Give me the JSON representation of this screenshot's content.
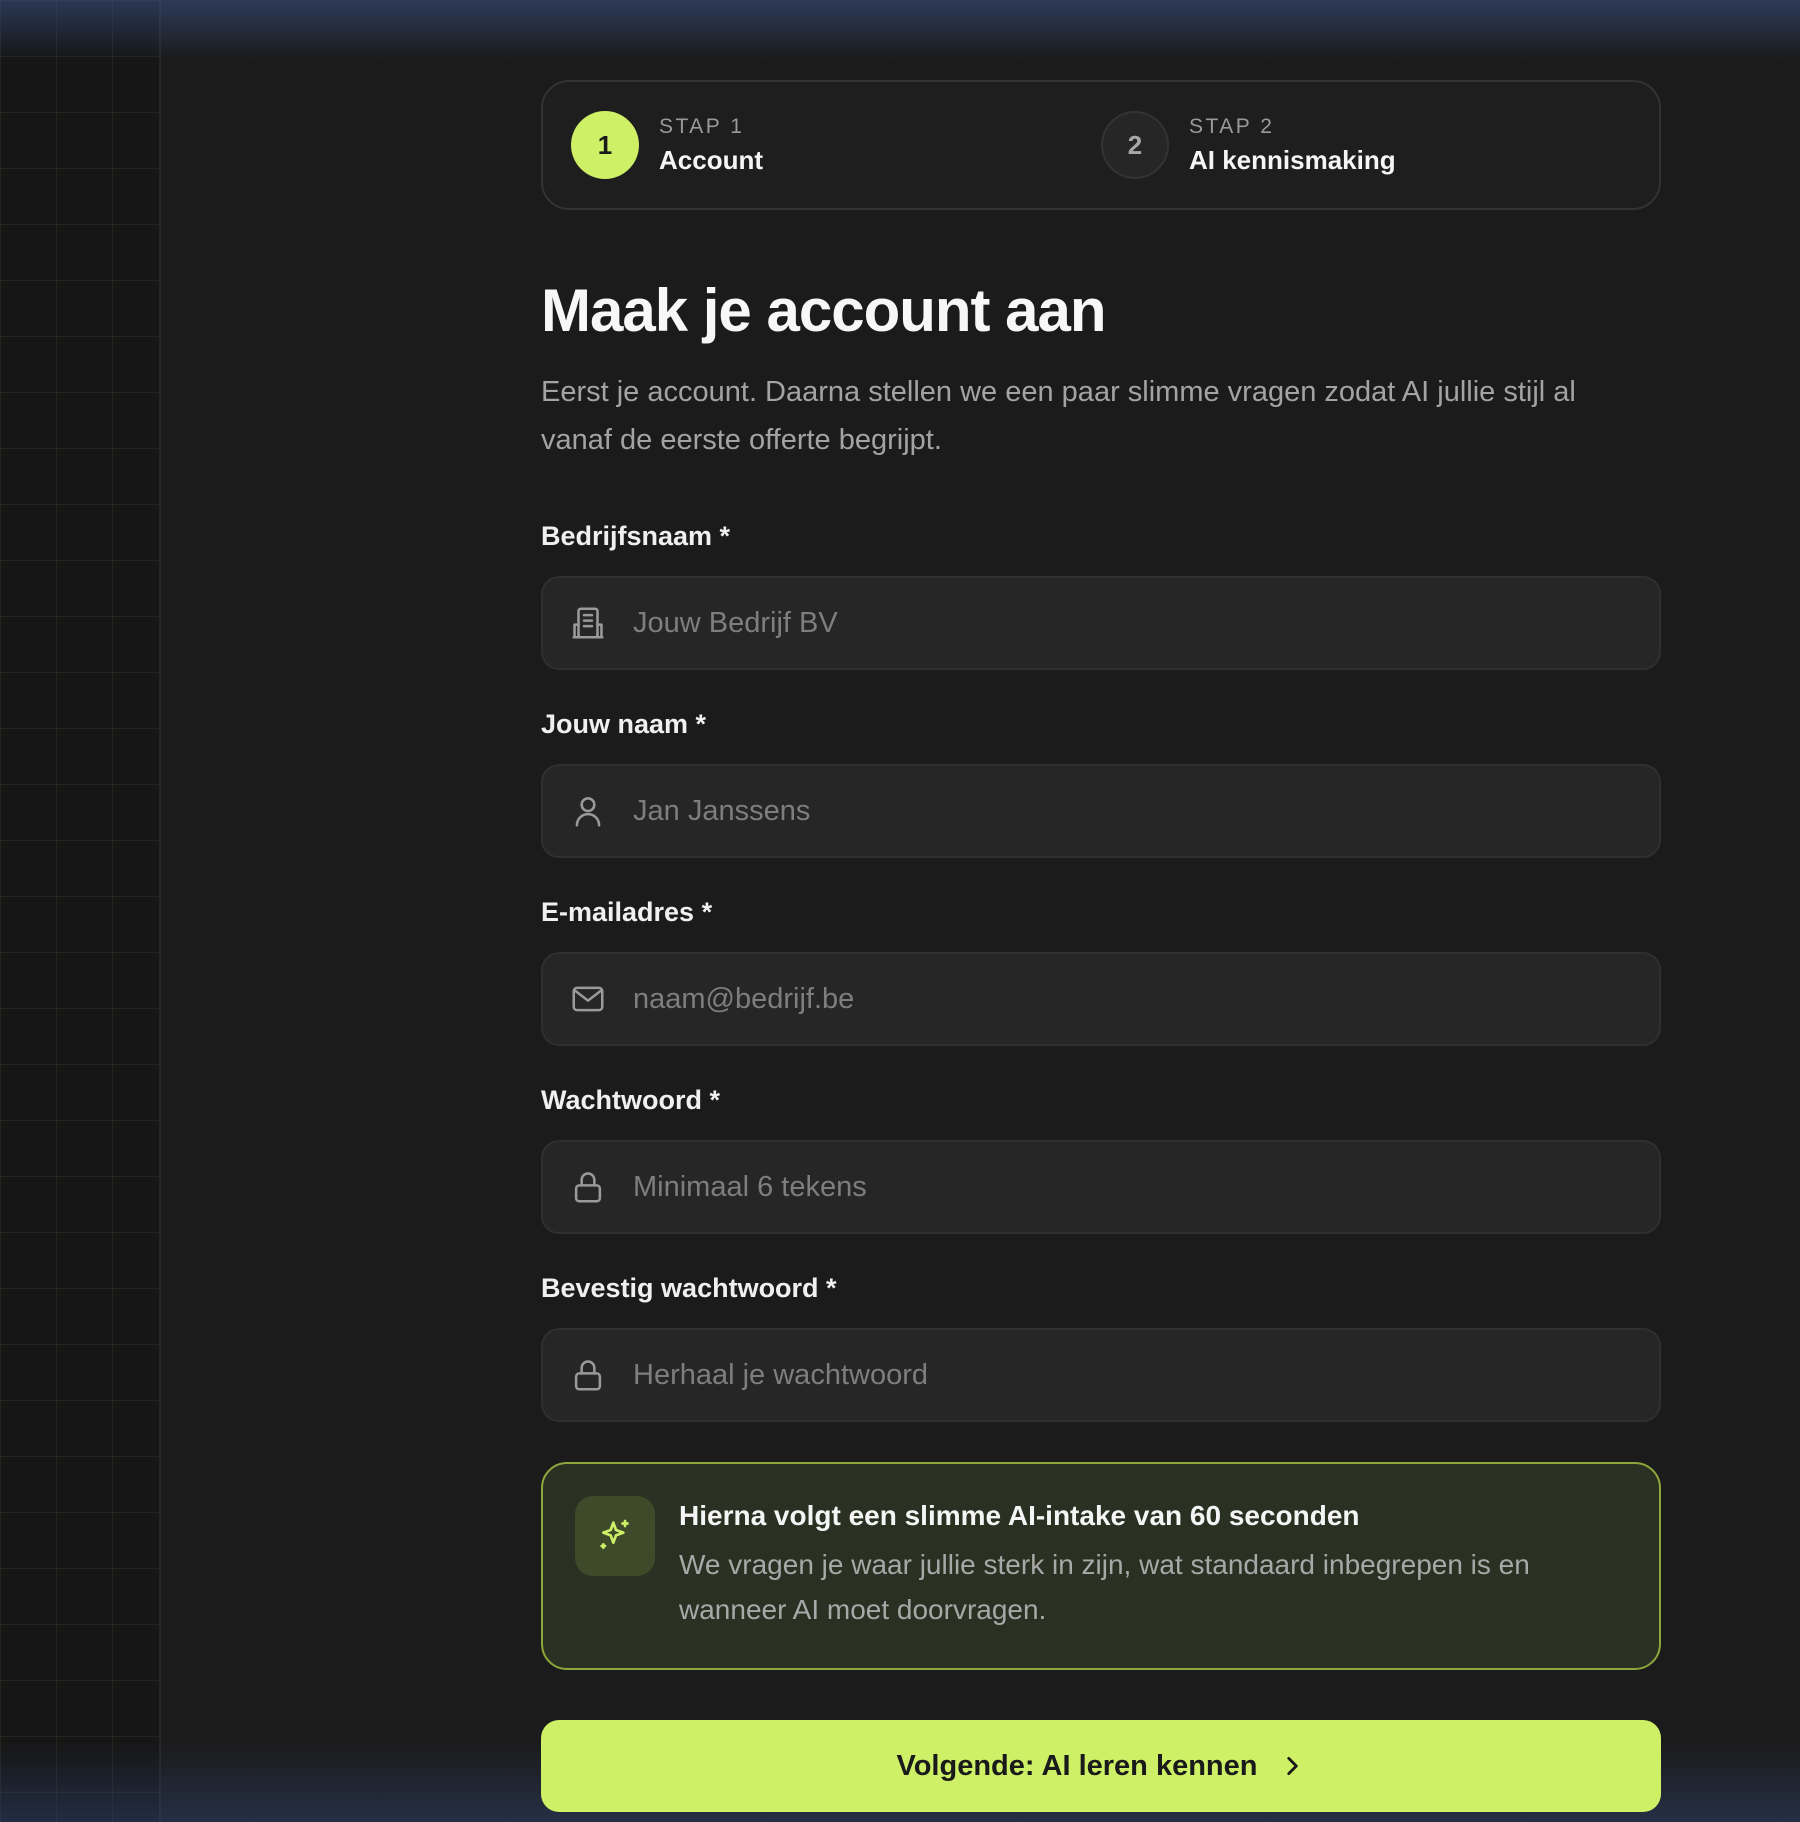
{
  "colors": {
    "accent": "#cdf066",
    "background": "#1b1b1b",
    "input_background": "#262626",
    "info_border": "#8ea63c"
  },
  "stepper": {
    "steps": [
      {
        "number": "1",
        "kicker": "STAP 1",
        "title": "Account",
        "state": "active"
      },
      {
        "number": "2",
        "kicker": "STAP 2",
        "title": "AI kennismaking",
        "state": "inactive"
      }
    ]
  },
  "header": {
    "title": "Maak je account aan",
    "subtitle": "Eerst je account. Daarna stellen we een paar slimme vragen zodat AI jullie stijl al vanaf de eerste offerte begrijpt."
  },
  "form": {
    "fields": [
      {
        "label": "Bedrijfsnaam *",
        "placeholder": "Jouw Bedrijf BV",
        "value": "",
        "icon": "building-icon"
      },
      {
        "label": "Jouw naam *",
        "placeholder": "Jan Janssens",
        "value": "",
        "icon": "user-icon"
      },
      {
        "label": "E-mailadres *",
        "placeholder": "naam@bedrijf.be",
        "value": "",
        "icon": "mail-icon"
      },
      {
        "label": "Wachtwoord *",
        "placeholder": "Minimaal 6 tekens",
        "value": "",
        "icon": "lock-icon"
      },
      {
        "label": "Bevestig wachtwoord *",
        "placeholder": "Herhaal je wachtwoord",
        "value": "",
        "icon": "lock-icon"
      }
    ]
  },
  "info": {
    "icon": "sparkles-icon",
    "title": "Hierna volgt een slimme AI-intake van 60 seconden",
    "body": "We vragen je waar jullie sterk in zijn, wat standaard inbegrepen is en wanneer AI moet doorvragen."
  },
  "actions": {
    "next_label": "Volgende: AI leren kennen",
    "next_icon": "chevron-right-icon"
  }
}
